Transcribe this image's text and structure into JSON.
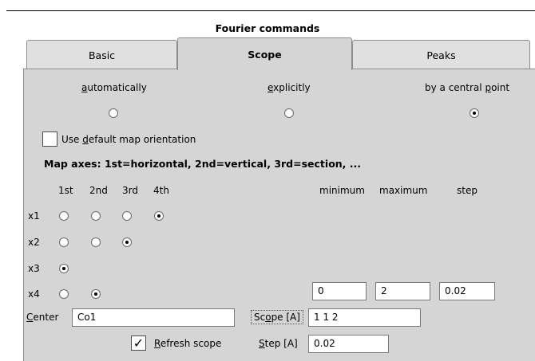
{
  "window": {
    "title": "Fourier commands"
  },
  "tabs": [
    {
      "label": "Basic"
    },
    {
      "label": "Scope"
    },
    {
      "label": "Peaks"
    }
  ],
  "mode": {
    "automatic": {
      "pre": "",
      "key": "a",
      "post": "utomatically",
      "selected": false
    },
    "explicit": {
      "pre": "",
      "key": "e",
      "post": "xplicitly",
      "selected": false
    },
    "central": {
      "pre": "by a central ",
      "key": "p",
      "post": "oint",
      "selected": true
    }
  },
  "default_orientation": {
    "pre": "Use ",
    "key": "d",
    "post": "efault map orientation",
    "checked": false
  },
  "map_axes_caption": "Map axes:  1st=horizontal, 2nd=vertical, 3rd=section, ...",
  "axis_headers": [
    "1st",
    "2nd",
    "3rd",
    "4th"
  ],
  "range_headers": {
    "min": "minimum",
    "max": "maximum",
    "step": "step"
  },
  "axes": [
    {
      "label": "x1",
      "selected": "4th"
    },
    {
      "label": "x2",
      "selected": "3rd"
    },
    {
      "label": "x3",
      "selected": "1st"
    },
    {
      "label": "x4",
      "selected": "2nd"
    }
  ],
  "x4_range": {
    "minimum": "0",
    "maximum": "2",
    "step": "0.02"
  },
  "center": {
    "key": "C",
    "rest": "enter",
    "value": "Co1"
  },
  "scope": {
    "pre": "Sc",
    "key": "o",
    "post": "pe [A]",
    "value": "1 1 2"
  },
  "refresh": {
    "key": "R",
    "rest": "efresh scope",
    "checked": true
  },
  "step": {
    "key": "S",
    "rest": "tep [A]",
    "value": "0.02"
  }
}
